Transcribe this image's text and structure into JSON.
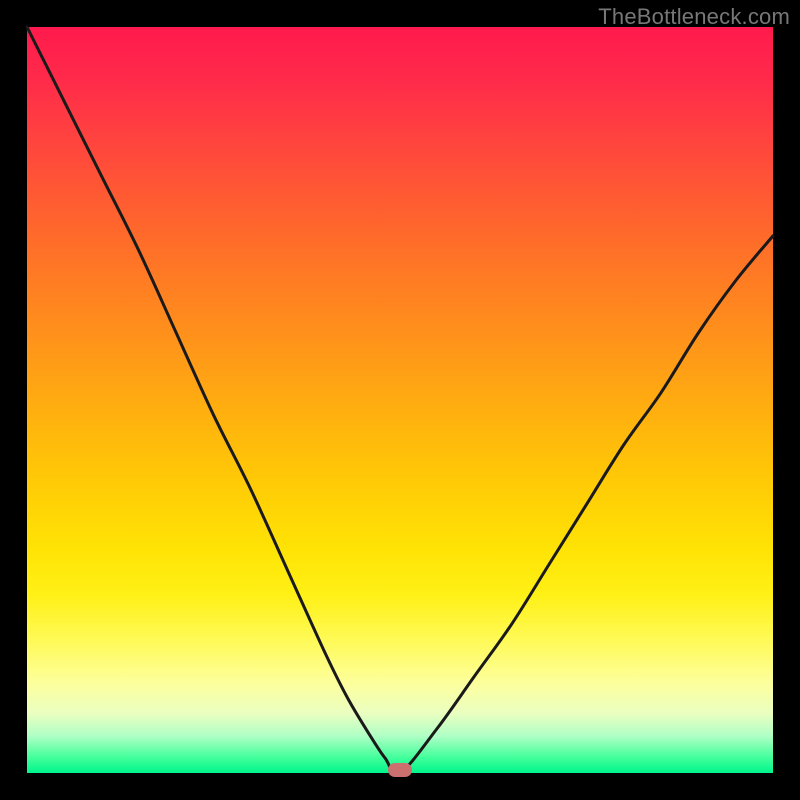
{
  "watermark": "TheBottleneck.com",
  "colors": {
    "frame": "#000000",
    "curve_stroke": "#1a1a1a",
    "marker": "#cc6f6f"
  },
  "chart_data": {
    "type": "line",
    "title": "",
    "xlabel": "",
    "ylabel": "",
    "xlim": [
      0,
      100
    ],
    "ylim": [
      0,
      100
    ],
    "x": [
      0,
      5,
      10,
      15,
      20,
      25,
      30,
      35,
      40,
      43,
      46,
      48,
      50,
      55,
      60,
      65,
      70,
      75,
      80,
      85,
      90,
      95,
      100
    ],
    "values": [
      100,
      90,
      80,
      70,
      59,
      48,
      38,
      27,
      16,
      10,
      5,
      2,
      0,
      6,
      13,
      20,
      28,
      36,
      44,
      51,
      59,
      66,
      72
    ],
    "minimum": {
      "x": 50,
      "y": 0
    },
    "annotations": [
      {
        "type": "marker",
        "x": 50,
        "y": 0
      }
    ]
  }
}
